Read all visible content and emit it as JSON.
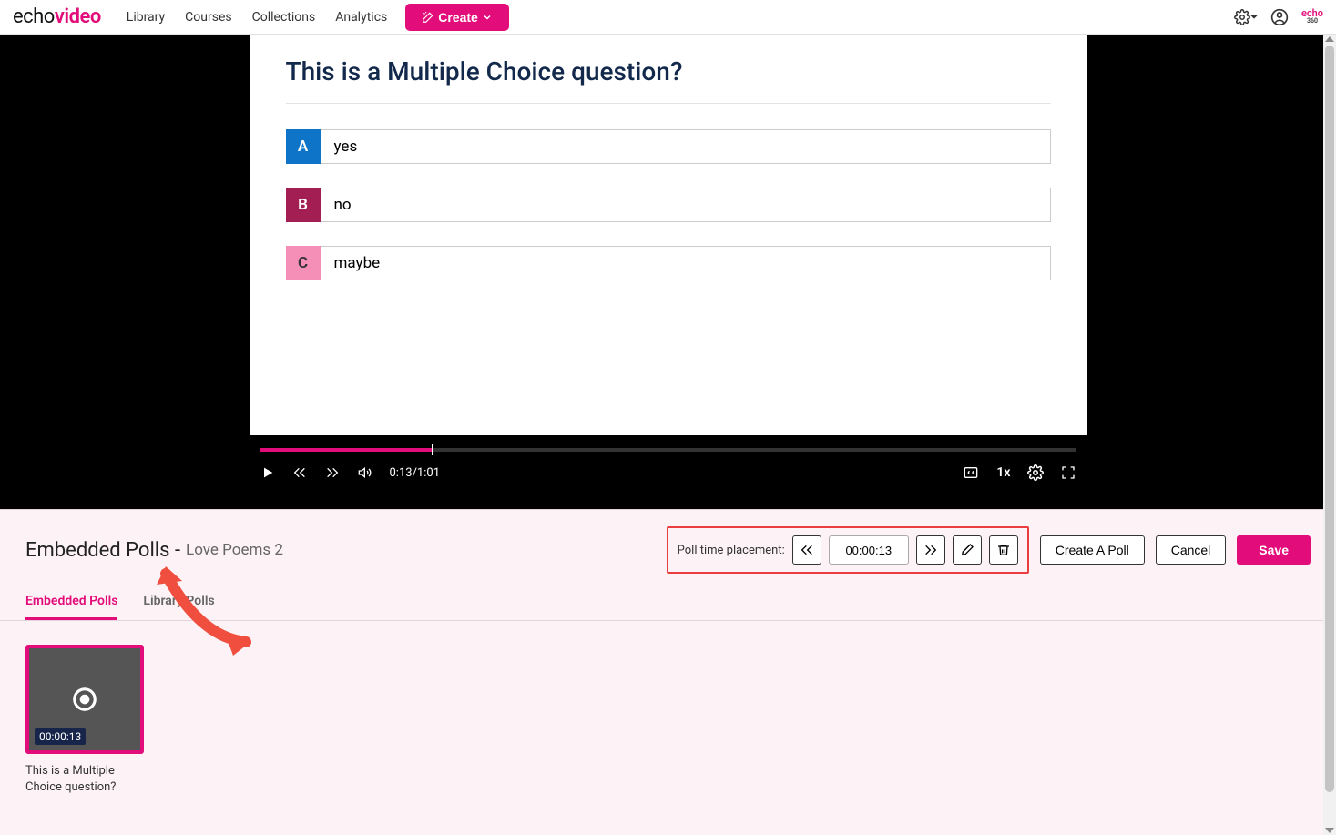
{
  "nav": {
    "links": [
      "Library",
      "Courses",
      "Collections",
      "Analytics"
    ],
    "create_label": "Create"
  },
  "question": {
    "title": "This is a Multiple Choice question?",
    "choices": [
      {
        "letter": "A",
        "text": "yes"
      },
      {
        "letter": "B",
        "text": "no"
      },
      {
        "letter": "C",
        "text": "maybe"
      }
    ]
  },
  "player": {
    "time_display": "0:13/1:01",
    "speed": "1x"
  },
  "editor": {
    "header_prefix": "Embedded Polls -",
    "header_title": "Love Poems 2",
    "placement_label": "Poll time placement:",
    "placement_value": "00:00:13",
    "create_poll_label": "Create A Poll",
    "cancel_label": "Cancel",
    "save_label": "Save",
    "tabs": {
      "embedded": "Embedded Polls",
      "library": "Library Polls"
    },
    "poll_card": {
      "time": "00:00:13",
      "caption": "This is a Multiple Choice question?"
    }
  }
}
